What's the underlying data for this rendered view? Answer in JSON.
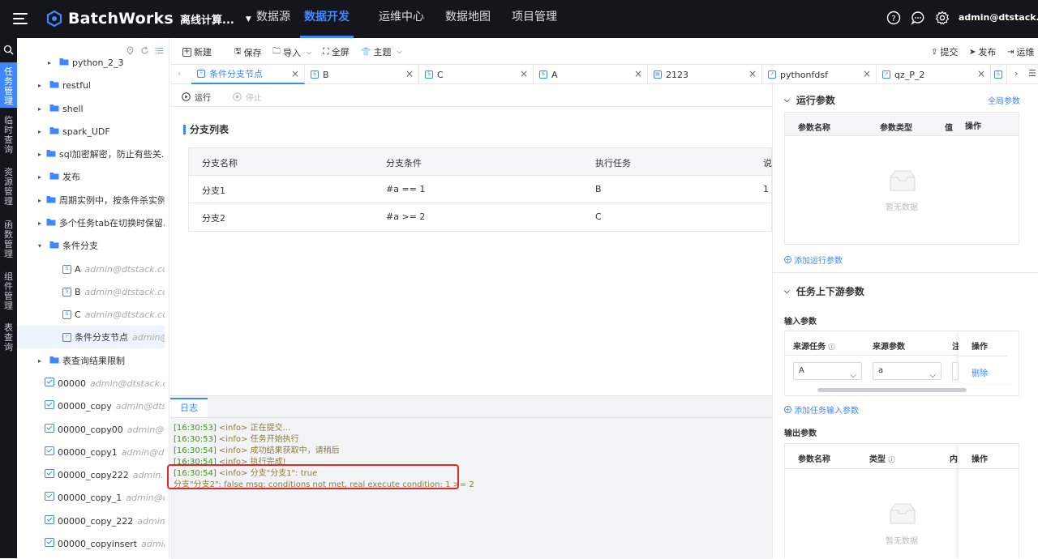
{
  "brand": {
    "name": "BatchWorks",
    "accent": "#3f87ff",
    "dark": "#14161c"
  },
  "topnav": {
    "product": "离线计算...",
    "tabs": [
      "数据源",
      "数据开发",
      "运维中心",
      "数据地图",
      "项目管理"
    ],
    "user": "admin@dtstack.com"
  },
  "leftbar": [
    "任务管理",
    "临时查询",
    "资源管理",
    "函数管理",
    "组件管理",
    "表查询"
  ],
  "sidebar": {
    "items": [
      {
        "label": "python_2_3",
        "owner": ""
      },
      {
        "label": "restful",
        "owner": ""
      },
      {
        "label": "shell",
        "owner": ""
      },
      {
        "label": "spark_UDF",
        "owner": ""
      },
      {
        "label": "sql加密解密，防止有些关...",
        "owner": ""
      },
      {
        "label": "发布",
        "owner": ""
      },
      {
        "label": "周期实例中，按条件杀实例...",
        "owner": ""
      },
      {
        "label": "多个任务tab在切换时保留...",
        "owner": ""
      },
      {
        "label": "条件分支",
        "owner": ""
      },
      {
        "label": "A",
        "owner": "admin@dtstack.co..."
      },
      {
        "label": "B",
        "owner": "admin@dtstack.co..."
      },
      {
        "label": "C",
        "owner": "admin@dtstack.co..."
      },
      {
        "label": "条件分支节点",
        "owner": "admin@..."
      },
      {
        "label": "表查询结果限制",
        "owner": ""
      },
      {
        "label": "00000",
        "owner": "admin@dtstack.co..."
      },
      {
        "label": "00000_copy",
        "owner": "admin@dts..."
      },
      {
        "label": "00000_copy00",
        "owner": "admin@..."
      },
      {
        "label": "00000_copy1",
        "owner": "admin@dt..."
      },
      {
        "label": "00000_copy222",
        "owner": "admin..."
      },
      {
        "label": "00000_copy_1",
        "owner": "admin@d..."
      },
      {
        "label": "00000_copy_222",
        "owner": "admin..."
      },
      {
        "label": "00000_copyinsert",
        "owner": "admin..."
      }
    ]
  },
  "toolbar": {
    "new": "新建",
    "save": "保存",
    "import": "导入",
    "fullscreen": "全屏",
    "theme": "主题",
    "submit": "提交",
    "publish": "发布",
    "ops": "运维"
  },
  "tabs": [
    {
      "label": "条件分支节点",
      "icon": "branch"
    },
    {
      "label": "B",
      "icon": "S"
    },
    {
      "label": "C",
      "icon": "S"
    },
    {
      "label": "A",
      "icon": "S"
    },
    {
      "label": "2123",
      "icon": "sql"
    },
    {
      "label": "pythonfdsf",
      "icon": "py"
    },
    {
      "label": "qz_P_2",
      "icon": "py"
    }
  ],
  "run": {
    "run": "运行",
    "stop": "停止"
  },
  "branch": {
    "title": "分支列表",
    "headers": [
      "分支名称",
      "分支条件",
      "执行任务",
      "说"
    ],
    "rows": [
      {
        "name": "分支1",
        "cond": "#a == 1",
        "task": "B",
        "desc": "1"
      },
      {
        "name": "分支2",
        "cond": "#a >= 2",
        "task": "C",
        "desc": ""
      }
    ]
  },
  "log": {
    "tab": "日志",
    "lines": [
      {
        "ts": "[16:30:53]",
        "msg": " <info> 正在提交..."
      },
      {
        "ts": "[16:30:53]",
        "msg": " <info> 任务开始执行"
      },
      {
        "ts": "[16:30:54]",
        "msg": " <info> 成功结果获取中，请稍后"
      },
      {
        "ts": "[16:30:54]",
        "msg": " <info> 执行完成!"
      },
      {
        "ts": "[16:30:54]",
        "msg": " <info> 分支\"分支1\": true"
      },
      {
        "ts": "",
        "msg": "分支\"分支2\": false msg: conditions not met, real execute condition: 1 >= 2"
      }
    ]
  },
  "right": {
    "run_params": {
      "title": "运行参数",
      "global": "全局参数",
      "headers": [
        "参数名称",
        "参数类型",
        "值",
        "操作"
      ],
      "empty": "暂无数据",
      "add": "添加运行参数"
    },
    "io": {
      "title": "任务上下游参数",
      "input_label": "输入参数",
      "in_headers": [
        "来源任务",
        "来源参数",
        "注",
        "操作"
      ],
      "row": {
        "task": "A",
        "param": "a",
        "action": "删除"
      },
      "add": "添加任务输入参数",
      "output_label": "输出参数",
      "out_headers": [
        "参数名称",
        "类型",
        "内",
        "操作"
      ],
      "empty": "暂无数据"
    }
  }
}
